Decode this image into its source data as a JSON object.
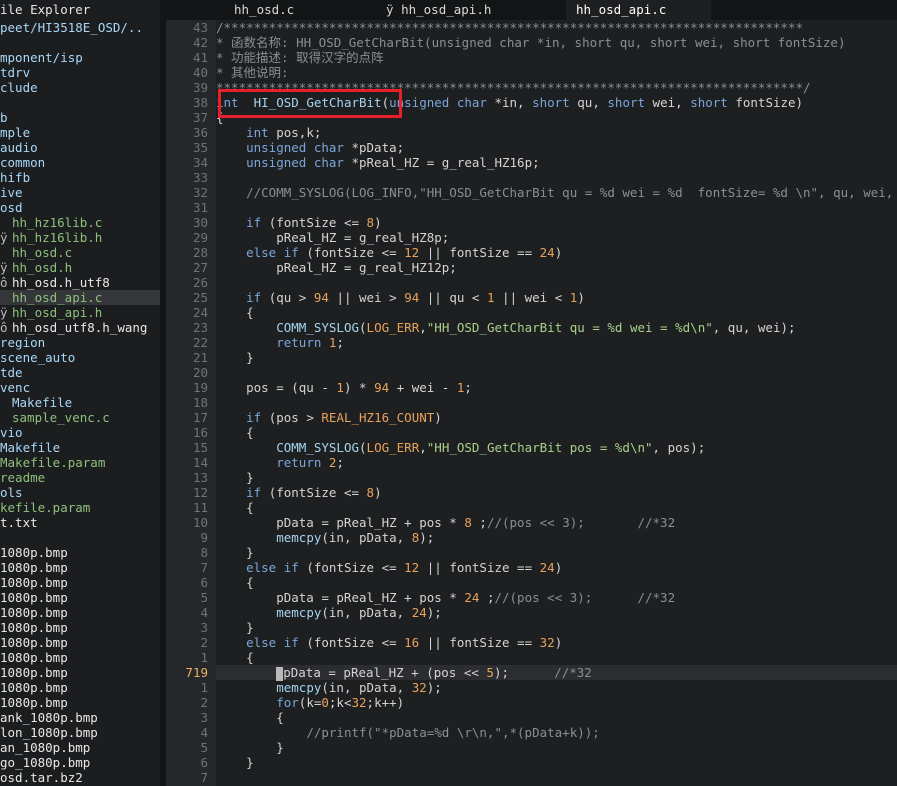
{
  "explorer": {
    "title": "ile Explorer",
    "items": [
      {
        "text": "peet/HI3518E_OSD/..",
        "kind": "dir",
        "mark": ""
      },
      {
        "text": "",
        "kind": "dir",
        "mark": ""
      },
      {
        "text": "mponent/isp",
        "kind": "dir",
        "mark": ""
      },
      {
        "text": "tdrv",
        "kind": "dir",
        "mark": ""
      },
      {
        "text": "clude",
        "kind": "dir",
        "mark": ""
      },
      {
        "text": "",
        "kind": "dir",
        "mark": ""
      },
      {
        "text": "b",
        "kind": "dir",
        "mark": ""
      },
      {
        "text": "mple",
        "kind": "dir",
        "mark": ""
      },
      {
        "text": "audio",
        "kind": "dir",
        "mark": ""
      },
      {
        "text": "common",
        "kind": "dir",
        "mark": ""
      },
      {
        "text": "hifb",
        "kind": "dir",
        "mark": ""
      },
      {
        "text": "ive",
        "kind": "dir",
        "mark": ""
      },
      {
        "text": "osd",
        "kind": "dir",
        "mark": ""
      },
      {
        "text": "hh_hz16lib.c",
        "kind": "green",
        "mark": " "
      },
      {
        "text": "hh_hz16lib.h",
        "kind": "green",
        "mark": "ÿ"
      },
      {
        "text": "hh_osd.c",
        "kind": "green",
        "mark": " "
      },
      {
        "text": "hh_osd.h",
        "kind": "green",
        "mark": "ÿ"
      },
      {
        "text": "hh_osd.h_utf8",
        "kind": "file",
        "mark": "ô"
      },
      {
        "text": "hh_osd_api.c",
        "kind": "green",
        "mark": " ",
        "selected": true
      },
      {
        "text": "hh_osd_api.h",
        "kind": "green",
        "mark": "ÿ"
      },
      {
        "text": "hh_osd_utf8.h_wang",
        "kind": "file",
        "mark": "ô"
      },
      {
        "text": "region",
        "kind": "dir",
        "mark": ""
      },
      {
        "text": "scene_auto",
        "kind": "dir",
        "mark": ""
      },
      {
        "text": "tde",
        "kind": "dir",
        "mark": ""
      },
      {
        "text": "venc",
        "kind": "dir",
        "mark": ""
      },
      {
        "text": "Makefile",
        "kind": "dir",
        "mark": " "
      },
      {
        "text": "sample_venc.c",
        "kind": "green",
        "mark": " "
      },
      {
        "text": "vio",
        "kind": "dir",
        "mark": ""
      },
      {
        "text": "Makefile",
        "kind": "dir",
        "mark": ""
      },
      {
        "text": "Makefile.param",
        "kind": "green",
        "mark": ""
      },
      {
        "text": "readme",
        "kind": "green",
        "mark": ""
      },
      {
        "text": "ols",
        "kind": "dir",
        "mark": ""
      },
      {
        "text": "kefile.param",
        "kind": "green",
        "mark": ""
      },
      {
        "text": "t.txt",
        "kind": "file",
        "mark": ""
      },
      {
        "text": "",
        "kind": "file",
        "mark": ""
      },
      {
        "text": "1080p.bmp",
        "kind": "file",
        "mark": ""
      },
      {
        "text": "1080p.bmp",
        "kind": "file",
        "mark": ""
      },
      {
        "text": "1080p.bmp",
        "kind": "file",
        "mark": ""
      },
      {
        "text": "1080p.bmp",
        "kind": "file",
        "mark": ""
      },
      {
        "text": "1080p.bmp",
        "kind": "file",
        "mark": ""
      },
      {
        "text": "1080p.bmp",
        "kind": "file",
        "mark": ""
      },
      {
        "text": "1080p.bmp",
        "kind": "file",
        "mark": ""
      },
      {
        "text": "1080p.bmp",
        "kind": "file",
        "mark": ""
      },
      {
        "text": "1080p.bmp",
        "kind": "file",
        "mark": ""
      },
      {
        "text": "1080p.bmp",
        "kind": "file",
        "mark": ""
      },
      {
        "text": "1080p.bmp",
        "kind": "file",
        "mark": ""
      },
      {
        "text": "ank_1080p.bmp",
        "kind": "file",
        "mark": ""
      },
      {
        "text": "lon_1080p.bmp",
        "kind": "file",
        "mark": ""
      },
      {
        "text": "an_1080p.bmp",
        "kind": "file",
        "mark": ""
      },
      {
        "text": "go_1080p.bmp",
        "kind": "file",
        "mark": ""
      },
      {
        "text": "osd.tar.bz2",
        "kind": "file",
        "mark": ""
      }
    ]
  },
  "tabs": [
    {
      "label": "hh_osd.c",
      "mark": ""
    },
    {
      "label": "hh_osd_api.h",
      "mark": "ÿ"
    },
    {
      "label": "hh_osd_api.c",
      "mark": "",
      "active": true
    }
  ],
  "gutter": [
    "43",
    "42",
    "41",
    "40",
    "39",
    "38",
    "37",
    "36",
    "35",
    "34",
    "33",
    "32",
    "31",
    "30",
    "29",
    "28",
    "27",
    "26",
    "25",
    "24",
    "23",
    "22",
    "21",
    "20",
    "19",
    "18",
    "17",
    "16",
    "15",
    "14",
    "13",
    "12",
    "11",
    "10",
    "9",
    "8",
    "7",
    "6",
    "5",
    "4",
    "3",
    "2",
    "1",
    "719",
    "1",
    "2",
    "3",
    "4",
    "5",
    "6",
    "7"
  ],
  "current_line_index": 43,
  "code": [
    [
      [
        "cmt",
        "/*****************************************************************************"
      ]
    ],
    [
      [
        "cmt",
        "* 函数名称: HH_OSD_GetCharBit(unsigned char *in, short qu, short wei, short fontSize)"
      ]
    ],
    [
      [
        "cmt",
        "* 功能描述: 取得汉字的点阵"
      ]
    ],
    [
      [
        "cmt",
        "* 其他说明:"
      ]
    ],
    [
      [
        "cmt",
        "******************************************************************************/"
      ]
    ],
    [
      [
        "ty",
        "int"
      ],
      [
        "",
        "  "
      ],
      [
        "fn",
        "HI_OSD_GetCharBit"
      ],
      [
        "",
        "("
      ],
      [
        "ty",
        "unsigned char"
      ],
      [
        "",
        " *in, "
      ],
      [
        "ty",
        "short"
      ],
      [
        "",
        " qu, "
      ],
      [
        "ty",
        "short"
      ],
      [
        "",
        " wei, "
      ],
      [
        "ty",
        "short"
      ],
      [
        "",
        " fontSize)"
      ]
    ],
    [
      [
        "",
        "{"
      ]
    ],
    [
      [
        "",
        "    "
      ],
      [
        "ty",
        "int"
      ],
      [
        "",
        " pos,k;"
      ]
    ],
    [
      [
        "",
        "    "
      ],
      [
        "ty",
        "unsigned char"
      ],
      [
        "",
        " *pData;"
      ]
    ],
    [
      [
        "",
        "    "
      ],
      [
        "ty",
        "unsigned char"
      ],
      [
        "",
        " *pReal_HZ = g_real_HZ16p;"
      ]
    ],
    [
      [
        "",
        ""
      ]
    ],
    [
      [
        "",
        "    "
      ],
      [
        "cmt",
        "//COMM_SYSLOG(LOG_INFO,\"HH_OSD_GetCharBit qu = %d wei = %d  fontSize= %d \\n\", qu, wei, fontSize);"
      ]
    ],
    [
      [
        "",
        ""
      ]
    ],
    [
      [
        "",
        "    "
      ],
      [
        "kw",
        "if"
      ],
      [
        "",
        " (fontSize <= "
      ],
      [
        "num",
        "8"
      ],
      [
        "",
        ")"
      ]
    ],
    [
      [
        "",
        "        pReal_HZ = g_real_HZ8p;"
      ]
    ],
    [
      [
        "",
        "    "
      ],
      [
        "kw",
        "else if"
      ],
      [
        "",
        " (fontSize <= "
      ],
      [
        "num",
        "12"
      ],
      [
        "",
        " || fontSize == "
      ],
      [
        "num",
        "24"
      ],
      [
        "",
        ")"
      ]
    ],
    [
      [
        "",
        "        pReal_HZ = g_real_HZ12p;"
      ]
    ],
    [
      [
        "",
        ""
      ]
    ],
    [
      [
        "",
        "    "
      ],
      [
        "kw",
        "if"
      ],
      [
        "",
        " (qu > "
      ],
      [
        "num",
        "94"
      ],
      [
        "",
        " || wei > "
      ],
      [
        "num",
        "94"
      ],
      [
        "",
        " || qu < "
      ],
      [
        "num",
        "1"
      ],
      [
        "",
        " || wei < "
      ],
      [
        "num",
        "1"
      ],
      [
        "",
        ")"
      ]
    ],
    [
      [
        "",
        "    {"
      ]
    ],
    [
      [
        "",
        "        "
      ],
      [
        "fn",
        "COMM_SYSLOG"
      ],
      [
        "",
        "("
      ],
      [
        "mac",
        "LOG_ERR"
      ],
      [
        "",
        ","
      ],
      [
        "str",
        "\"HH_OSD_GetCharBit qu = %d wei = %d\\n\""
      ],
      [
        "",
        ", qu, wei);"
      ]
    ],
    [
      [
        "",
        "        "
      ],
      [
        "kw",
        "return"
      ],
      [
        "",
        " "
      ],
      [
        "num",
        "1"
      ],
      [
        "",
        ";"
      ]
    ],
    [
      [
        "",
        "    }"
      ]
    ],
    [
      [
        "",
        ""
      ]
    ],
    [
      [
        "",
        "    pos = (qu - "
      ],
      [
        "num",
        "1"
      ],
      [
        "",
        ") * "
      ],
      [
        "num",
        "94"
      ],
      [
        "",
        " + wei - "
      ],
      [
        "num",
        "1"
      ],
      [
        "",
        ";"
      ]
    ],
    [
      [
        "",
        ""
      ]
    ],
    [
      [
        "",
        "    "
      ],
      [
        "kw",
        "if"
      ],
      [
        "",
        " (pos > "
      ],
      [
        "mac",
        "REAL_HZ16_COUNT"
      ],
      [
        "",
        ")"
      ]
    ],
    [
      [
        "",
        "    {"
      ]
    ],
    [
      [
        "",
        "        "
      ],
      [
        "fn",
        "COMM_SYSLOG"
      ],
      [
        "",
        "("
      ],
      [
        "mac",
        "LOG_ERR"
      ],
      [
        "",
        ","
      ],
      [
        "str",
        "\"HH_OSD_GetCharBit pos = %d\\n\""
      ],
      [
        "",
        ", pos);"
      ]
    ],
    [
      [
        "",
        "        "
      ],
      [
        "kw",
        "return"
      ],
      [
        "",
        " "
      ],
      [
        "num",
        "2"
      ],
      [
        "",
        ";"
      ]
    ],
    [
      [
        "",
        "    }"
      ]
    ],
    [
      [
        "",
        "    "
      ],
      [
        "kw",
        "if"
      ],
      [
        "",
        " (fontSize <= "
      ],
      [
        "num",
        "8"
      ],
      [
        "",
        ")"
      ]
    ],
    [
      [
        "",
        "    {"
      ]
    ],
    [
      [
        "",
        "        pData = pReal_HZ + pos * "
      ],
      [
        "num",
        "8"
      ],
      [
        "",
        " ;"
      ],
      [
        "cmt",
        "//(pos << 3);       //*32"
      ]
    ],
    [
      [
        "",
        "        "
      ],
      [
        "fn",
        "memcpy"
      ],
      [
        "",
        "(in, pData, "
      ],
      [
        "num",
        "8"
      ],
      [
        "",
        ");"
      ]
    ],
    [
      [
        "",
        "    }"
      ]
    ],
    [
      [
        "",
        "    "
      ],
      [
        "kw",
        "else if"
      ],
      [
        "",
        " (fontSize <= "
      ],
      [
        "num",
        "12"
      ],
      [
        "",
        " || fontSize == "
      ],
      [
        "num",
        "24"
      ],
      [
        "",
        ")"
      ]
    ],
    [
      [
        "",
        "    {"
      ]
    ],
    [
      [
        "",
        "        pData = pReal_HZ + pos * "
      ],
      [
        "num",
        "24"
      ],
      [
        "",
        " ;"
      ],
      [
        "cmt",
        "//(pos << 3);      //*32"
      ]
    ],
    [
      [
        "",
        "        "
      ],
      [
        "fn",
        "memcpy"
      ],
      [
        "",
        "(in, pData, "
      ],
      [
        "num",
        "24"
      ],
      [
        "",
        ");"
      ]
    ],
    [
      [
        "",
        "    }"
      ]
    ],
    [
      [
        "",
        "    "
      ],
      [
        "kw",
        "else if"
      ],
      [
        "",
        " (fontSize <= "
      ],
      [
        "num",
        "16"
      ],
      [
        "",
        " || fontSize == "
      ],
      [
        "num",
        "32"
      ],
      [
        "",
        ")"
      ]
    ],
    [
      [
        "",
        "    {"
      ]
    ],
    [
      [
        "",
        "        "
      ],
      [
        "cursor",
        ""
      ],
      [
        "",
        "pData = pReal_HZ + (pos << "
      ],
      [
        "num",
        "5"
      ],
      [
        "",
        ");      "
      ],
      [
        "cmt",
        "//*32"
      ]
    ],
    [
      [
        "",
        "        "
      ],
      [
        "fn",
        "memcpy"
      ],
      [
        "",
        "(in, pData, "
      ],
      [
        "num",
        "32"
      ],
      [
        "",
        ");"
      ]
    ],
    [
      [
        "",
        "        "
      ],
      [
        "kw",
        "for"
      ],
      [
        "",
        "(k="
      ],
      [
        "num",
        "0"
      ],
      [
        "",
        ";k<"
      ],
      [
        "num",
        "32"
      ],
      [
        "",
        ";k++)"
      ]
    ],
    [
      [
        "",
        "        {"
      ]
    ],
    [
      [
        "",
        "            "
      ],
      [
        "cmt",
        "//printf(\"*pData=%d \\r\\n,\",*(pData+k));"
      ]
    ],
    [
      [
        "",
        "        }"
      ]
    ],
    [
      [
        "",
        "    }"
      ]
    ],
    [
      [
        "",
        ""
      ]
    ]
  ]
}
